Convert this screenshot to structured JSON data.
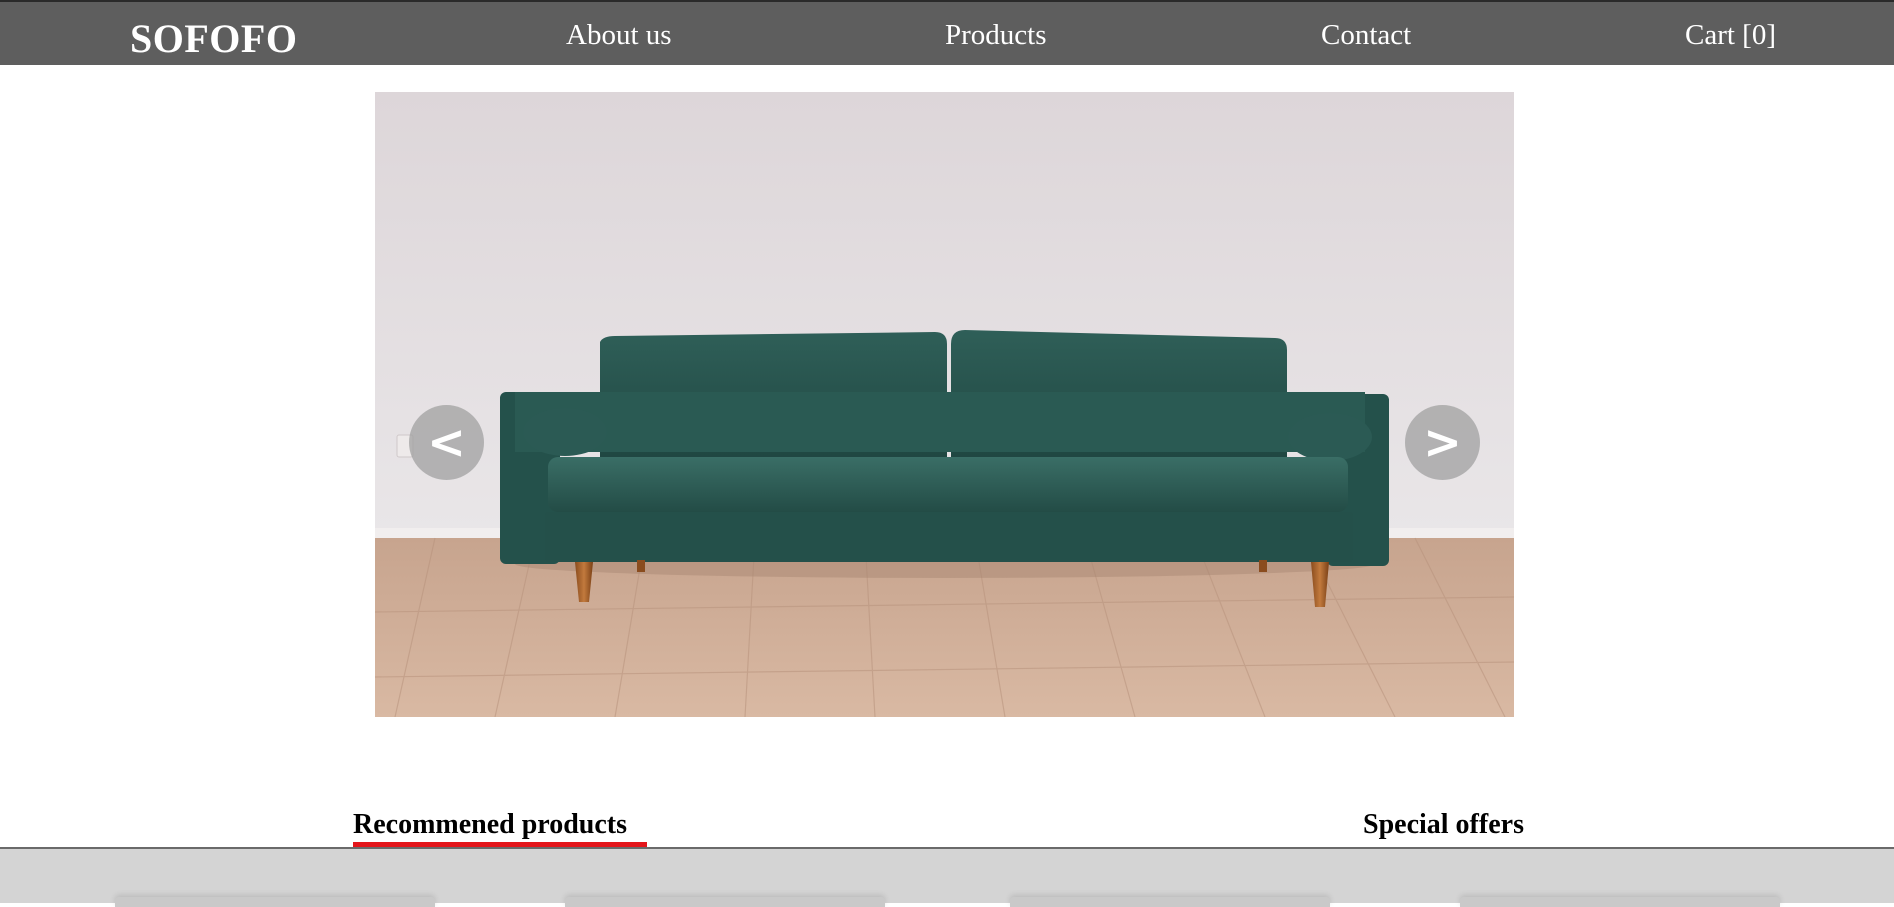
{
  "header": {
    "brand": "SOFOFO",
    "nav": {
      "about": "About us",
      "products": "Products",
      "contact": "Contact",
      "cart": "Cart [0]"
    }
  },
  "hero": {
    "image_icon": "sofa-photo",
    "prev_label": "<",
    "next_label": ">"
  },
  "sections": {
    "recommended": "Recommened products",
    "special": "Special offers",
    "active_tab": "recommended",
    "active_color": "#e3151a"
  },
  "colors": {
    "nav_background": "#5e5e5e",
    "strip_background": "#d4d4d4"
  }
}
